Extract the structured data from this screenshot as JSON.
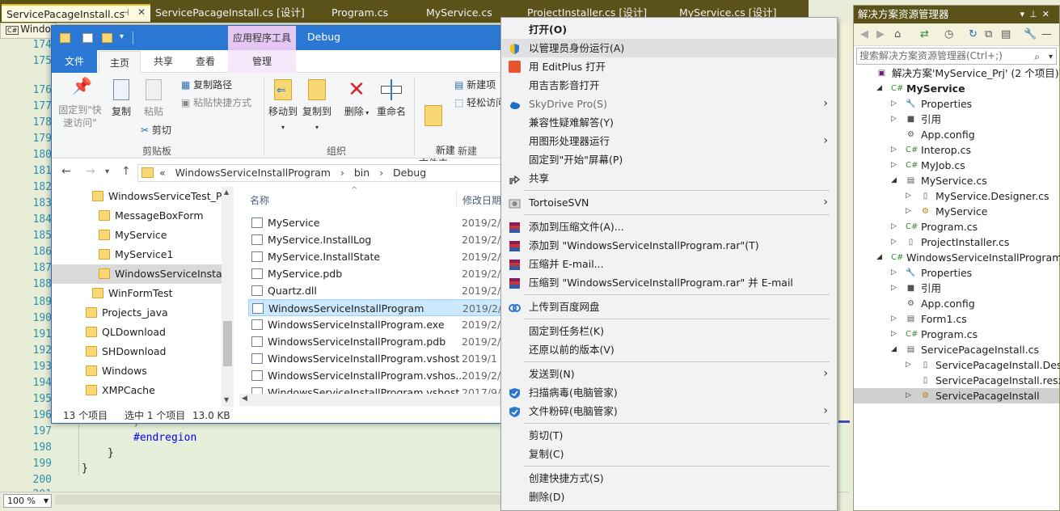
{
  "vs": {
    "tabs": [
      {
        "label": "ServicePacageInstall.cs"
      },
      {
        "label": "ServicePacageInstall.cs [设计]"
      },
      {
        "label": "Program.cs"
      },
      {
        "label": "MyService.cs"
      },
      {
        "label": "ProjectInstaller.cs [设计]"
      },
      {
        "label": "MyService.cs [设计]"
      }
    ],
    "nav_label": "Windo",
    "line_numbers": [
      "174",
      "175",
      "176",
      "177",
      "178",
      "179",
      "180",
      "181",
      "182",
      "183",
      "184",
      "185",
      "186",
      "187",
      "188",
      "189",
      "190",
      "191",
      "192",
      "193",
      "194",
      "195",
      "196",
      "197",
      "198",
      "199",
      "200",
      "201"
    ],
    "code": {
      "brace_197": "}",
      "endregion": "#endregion",
      "brace_199": "}",
      "brace_200": "}"
    },
    "zoom": "100 %"
  },
  "solution_explorer": {
    "title": "解决方案资源管理器",
    "search_placeholder": "搜索解决方案资源管理器(Ctrl+;)",
    "rows": [
      {
        "label": "解决方案'MyService_Prj' (2 个项目)",
        "indent": 0,
        "arrow": "",
        "icon": "solution"
      },
      {
        "label": "MyService",
        "indent": 1,
        "arrow": "open",
        "icon": "csproj",
        "bold": true
      },
      {
        "label": "Properties",
        "indent": 2,
        "arrow": "closed",
        "icon": "wrench"
      },
      {
        "label": "引用",
        "indent": 2,
        "arrow": "closed",
        "icon": "ref"
      },
      {
        "label": "App.config",
        "indent": 2,
        "arrow": "",
        "icon": "config"
      },
      {
        "label": "Interop.cs",
        "indent": 2,
        "arrow": "closed",
        "icon": "cs"
      },
      {
        "label": "MyJob.cs",
        "indent": 2,
        "arrow": "closed",
        "icon": "cs"
      },
      {
        "label": "MyService.cs",
        "indent": 2,
        "arrow": "open",
        "icon": "component"
      },
      {
        "label": "MyService.Designer.cs",
        "indent": 3,
        "arrow": "closed",
        "icon": "doc"
      },
      {
        "label": "MyService",
        "indent": 3,
        "arrow": "closed",
        "icon": "class"
      },
      {
        "label": "Program.cs",
        "indent": 2,
        "arrow": "closed",
        "icon": "cs"
      },
      {
        "label": "ProjectInstaller.cs",
        "indent": 2,
        "arrow": "closed",
        "icon": "doc"
      },
      {
        "label": "WindowsServiceInstallProgram",
        "indent": 1,
        "arrow": "open",
        "icon": "csproj"
      },
      {
        "label": "Properties",
        "indent": 2,
        "arrow": "closed",
        "icon": "wrench"
      },
      {
        "label": "引用",
        "indent": 2,
        "arrow": "closed",
        "icon": "ref"
      },
      {
        "label": "App.config",
        "indent": 2,
        "arrow": "",
        "icon": "config"
      },
      {
        "label": "Form1.cs",
        "indent": 2,
        "arrow": "closed",
        "icon": "form"
      },
      {
        "label": "Program.cs",
        "indent": 2,
        "arrow": "closed",
        "icon": "cs"
      },
      {
        "label": "ServicePacageInstall.cs",
        "indent": 2,
        "arrow": "open",
        "icon": "form"
      },
      {
        "label": "ServicePacageInstall.Design",
        "indent": 3,
        "arrow": "closed",
        "icon": "doc"
      },
      {
        "label": "ServicePacageInstall.resx",
        "indent": 3,
        "arrow": "",
        "icon": "doc"
      },
      {
        "label": "ServicePacageInstall",
        "indent": 3,
        "arrow": "closed",
        "icon": "class",
        "selected": true
      }
    ]
  },
  "explorer": {
    "context_tab": "应用程序工具",
    "title": "Debug",
    "tabs": {
      "file": "文件",
      "home": "主页",
      "share": "共享",
      "view": "查看",
      "manage": "管理"
    },
    "ribbon": {
      "pin": "固定到\"快\n速访问\"",
      "copy": "复制",
      "paste": "粘贴",
      "copy_path": "复制路径",
      "paste_shortcut": "粘贴快捷方式",
      "cut": "剪切",
      "group_clipboard": "剪贴板",
      "move_to": "移动到",
      "copy_to": "复制到",
      "delete": "删除",
      "rename": "重命名",
      "group_organize": "组织",
      "new_folder": "新建\n文件夹",
      "new_item": "新建项",
      "easy_access": "轻松访问",
      "group_new": "新建"
    },
    "address": {
      "sep": "«",
      "parts": [
        "WindowsServiceInstallProgram",
        "bin",
        "Debug"
      ]
    },
    "tree": [
      {
        "label": "WindowsServiceTest_Prj",
        "indent": 1
      },
      {
        "label": "MessageBoxForm",
        "indent": 2
      },
      {
        "label": "MyService",
        "indent": 2
      },
      {
        "label": "MyService1",
        "indent": 2
      },
      {
        "label": "WindowsServiceInstallP",
        "indent": 2,
        "selected": true
      },
      {
        "label": "WinFormTest",
        "indent": 1
      },
      {
        "label": "Projects_java",
        "indent": 0
      },
      {
        "label": "QLDownload",
        "indent": 0
      },
      {
        "label": "SHDownload",
        "indent": 0
      },
      {
        "label": "Windows",
        "indent": 0
      },
      {
        "label": "XMPCache",
        "indent": 0
      }
    ],
    "columns": {
      "name": "名称",
      "date": "修改日期"
    },
    "files": [
      {
        "name": "MyService",
        "date": "2019/2/"
      },
      {
        "name": "MyService.InstallLog",
        "date": "2019/2/"
      },
      {
        "name": "MyService.InstallState",
        "date": "2019/2/"
      },
      {
        "name": "MyService.pdb",
        "date": "2019/2/"
      },
      {
        "name": "Quartz.dll",
        "date": "2019/2/"
      },
      {
        "name": "WindowsServiceInstallProgram",
        "date": "2019/2/",
        "selected": true
      },
      {
        "name": "WindowsServiceInstallProgram.exe",
        "date": "2019/2/"
      },
      {
        "name": "WindowsServiceInstallProgram.pdb",
        "date": "2019/2/"
      },
      {
        "name": "WindowsServiceInstallProgram.vshost",
        "date": "2019/1"
      },
      {
        "name": "WindowsServiceInstallProgram.vshos...",
        "date": "2019/2/"
      },
      {
        "name": "WindowsServiceInstallProgram.vshost",
        "date": "2017/9/"
      }
    ],
    "status": {
      "count": "13 个项目",
      "selected": "选中 1 个项目",
      "size": "13.0 KB"
    }
  },
  "context_menu": {
    "items": [
      {
        "label": "打开(O)",
        "bold": true
      },
      {
        "label": "以管理员身份运行(A)",
        "icon": "shield",
        "hover": true
      },
      {
        "label": "用 EditPlus 打开",
        "icon": "editplus"
      },
      {
        "label": "用吉吉影音打开"
      },
      {
        "label": "SkyDrive Pro(S)",
        "icon": "cloud",
        "disabled": true,
        "submenu": true
      },
      {
        "label": "兼容性疑难解答(Y)"
      },
      {
        "label": "用图形处理器运行",
        "submenu": true
      },
      {
        "label": "固定到\"开始\"屏幕(P)"
      },
      {
        "label": "共享",
        "icon": "share"
      },
      {
        "sep": true
      },
      {
        "label": "TortoiseSVN",
        "icon": "svn",
        "submenu": true
      },
      {
        "sep": true
      },
      {
        "label": "添加到压缩文件(A)...",
        "icon": "rar"
      },
      {
        "label": "添加到 \"WindowsServiceInstallProgram.rar\"(T)",
        "icon": "rar"
      },
      {
        "label": "压缩并 E-mail...",
        "icon": "rar"
      },
      {
        "label": "压缩到 \"WindowsServiceInstallProgram.rar\" 并 E-mail",
        "icon": "rar"
      },
      {
        "sep": true
      },
      {
        "label": "上传到百度网盘",
        "icon": "baidu"
      },
      {
        "sep": true
      },
      {
        "label": "固定到任务栏(K)"
      },
      {
        "label": "还原以前的版本(V)"
      },
      {
        "sep": true
      },
      {
        "label": "发送到(N)",
        "submenu": true
      },
      {
        "label": "扫描病毒(电脑管家)",
        "icon": "guard"
      },
      {
        "label": "文件粉碎(电脑管家)",
        "icon": "guard",
        "submenu": true
      },
      {
        "sep": true
      },
      {
        "label": "剪切(T)"
      },
      {
        "label": "复制(C)"
      },
      {
        "sep": true
      },
      {
        "label": "创建快捷方式(S)"
      },
      {
        "label": "删除(D)"
      }
    ]
  }
}
